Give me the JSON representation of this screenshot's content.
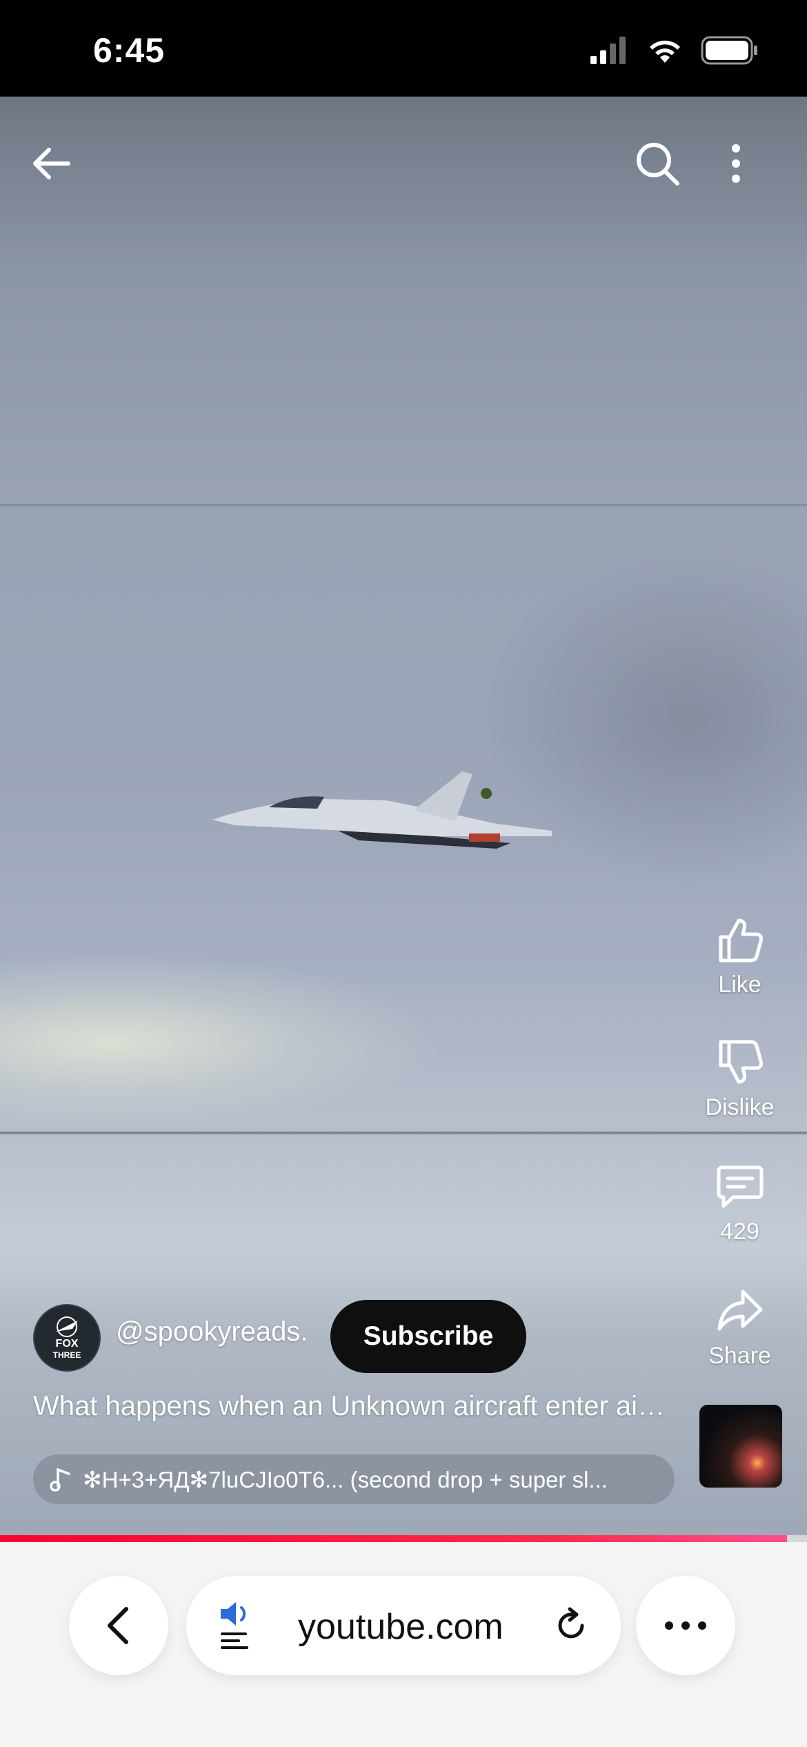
{
  "status": {
    "time": "6:45"
  },
  "channel": {
    "handle": "@spookyreads.",
    "avatar_text_1": "FOX",
    "avatar_text_2": "THREE"
  },
  "subscribe_label": "Subscribe",
  "video": {
    "title": "What happens when an Unknown aircraft enter airspace",
    "progress": 0.975
  },
  "music": {
    "text": "✻H+3+ЯД✻7luCJIo0T6... (second drop + super sl..."
  },
  "actions": {
    "like": "Like",
    "dislike": "Dislike",
    "comments": "429",
    "share": "Share"
  },
  "browser": {
    "url": "youtube.com"
  },
  "icons": [
    "back-arrow-icon",
    "search-icon",
    "more-vert-icon",
    "thumb-up-icon",
    "thumb-down-icon",
    "comment-icon",
    "share-icon",
    "music-note-icon",
    "speaker-icon",
    "reload-icon",
    "chevron-left-icon",
    "ellipsis-icon"
  ]
}
